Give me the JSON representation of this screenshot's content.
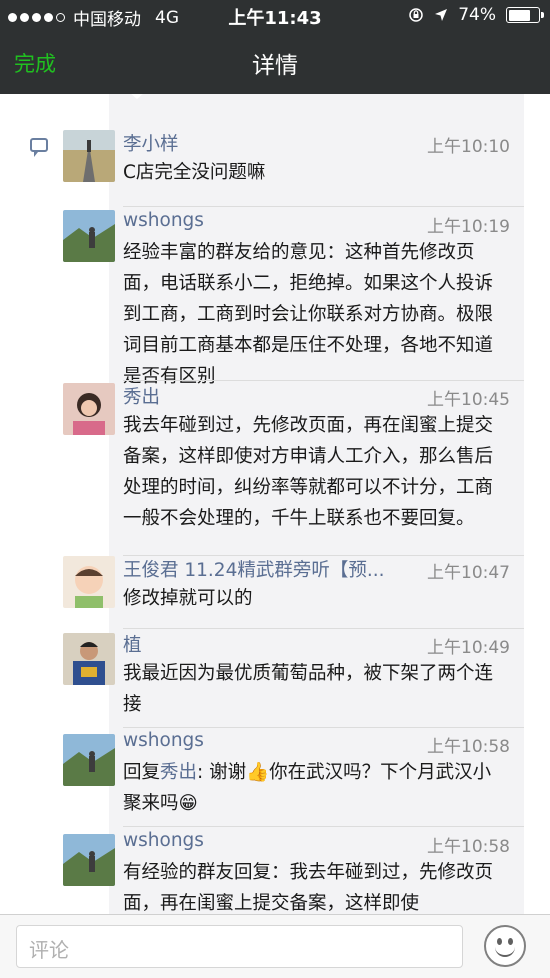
{
  "status_bar": {
    "carrier": "中国移动",
    "network": "4G",
    "time": "上午11:43",
    "battery_percent": "74%",
    "battery_level": 0.74
  },
  "nav": {
    "done_label": "完成",
    "title": "详情"
  },
  "comments": [
    {
      "name": "李小样",
      "time": "上午10:10",
      "text": "C店完全没问题嘛"
    },
    {
      "name": "wshongs",
      "time": "上午10:19",
      "text": "经验丰富的群友给的意见：这种首先修改页面，电话联系小二，拒绝掉。如果这个人投诉到工商，工商到时会让你联系对方协商。极限词目前工商基本都是压住不处理，各地不知道是否有区别"
    },
    {
      "name": "秀出",
      "time": "上午10:45",
      "text": "我去年碰到过，先修改页面，再在闺蜜上提交备案，这样即使对方申请人工介入，那么售后处理的时间，纠纷率等就都可以不计分，工商一般不会处理的，千牛上联系也不要回复。"
    },
    {
      "name": "王俊君 11.24精武群旁听【预...",
      "time": "上午10:47",
      "text": "修改掉就可以的"
    },
    {
      "name": "植",
      "time": "上午10:49",
      "text": "我最近因为最优质葡萄品种，被下架了两个连接"
    },
    {
      "name": "wshongs",
      "time": "上午10:58",
      "reply_prefix": "回复",
      "reply_to": "秀出",
      "text": ": 谢谢👍你在武汉吗？下个月武汉小聚来吗😁"
    },
    {
      "name": "wshongs",
      "time": "上午10:58",
      "text": "有经验的群友回复：我去年碰到过，先修改页面，再在闺蜜上提交备案，这样即使"
    }
  ],
  "comment_input": {
    "placeholder": "评论"
  },
  "icons": {
    "comment": "comment-bubble-icon",
    "emoji": "emoji-smile-icon"
  },
  "colors": {
    "nav_bg": "#2e3132",
    "done_green": "#20c020",
    "name_blue": "#5a6e92",
    "panel_bg": "#f3f3f5"
  }
}
